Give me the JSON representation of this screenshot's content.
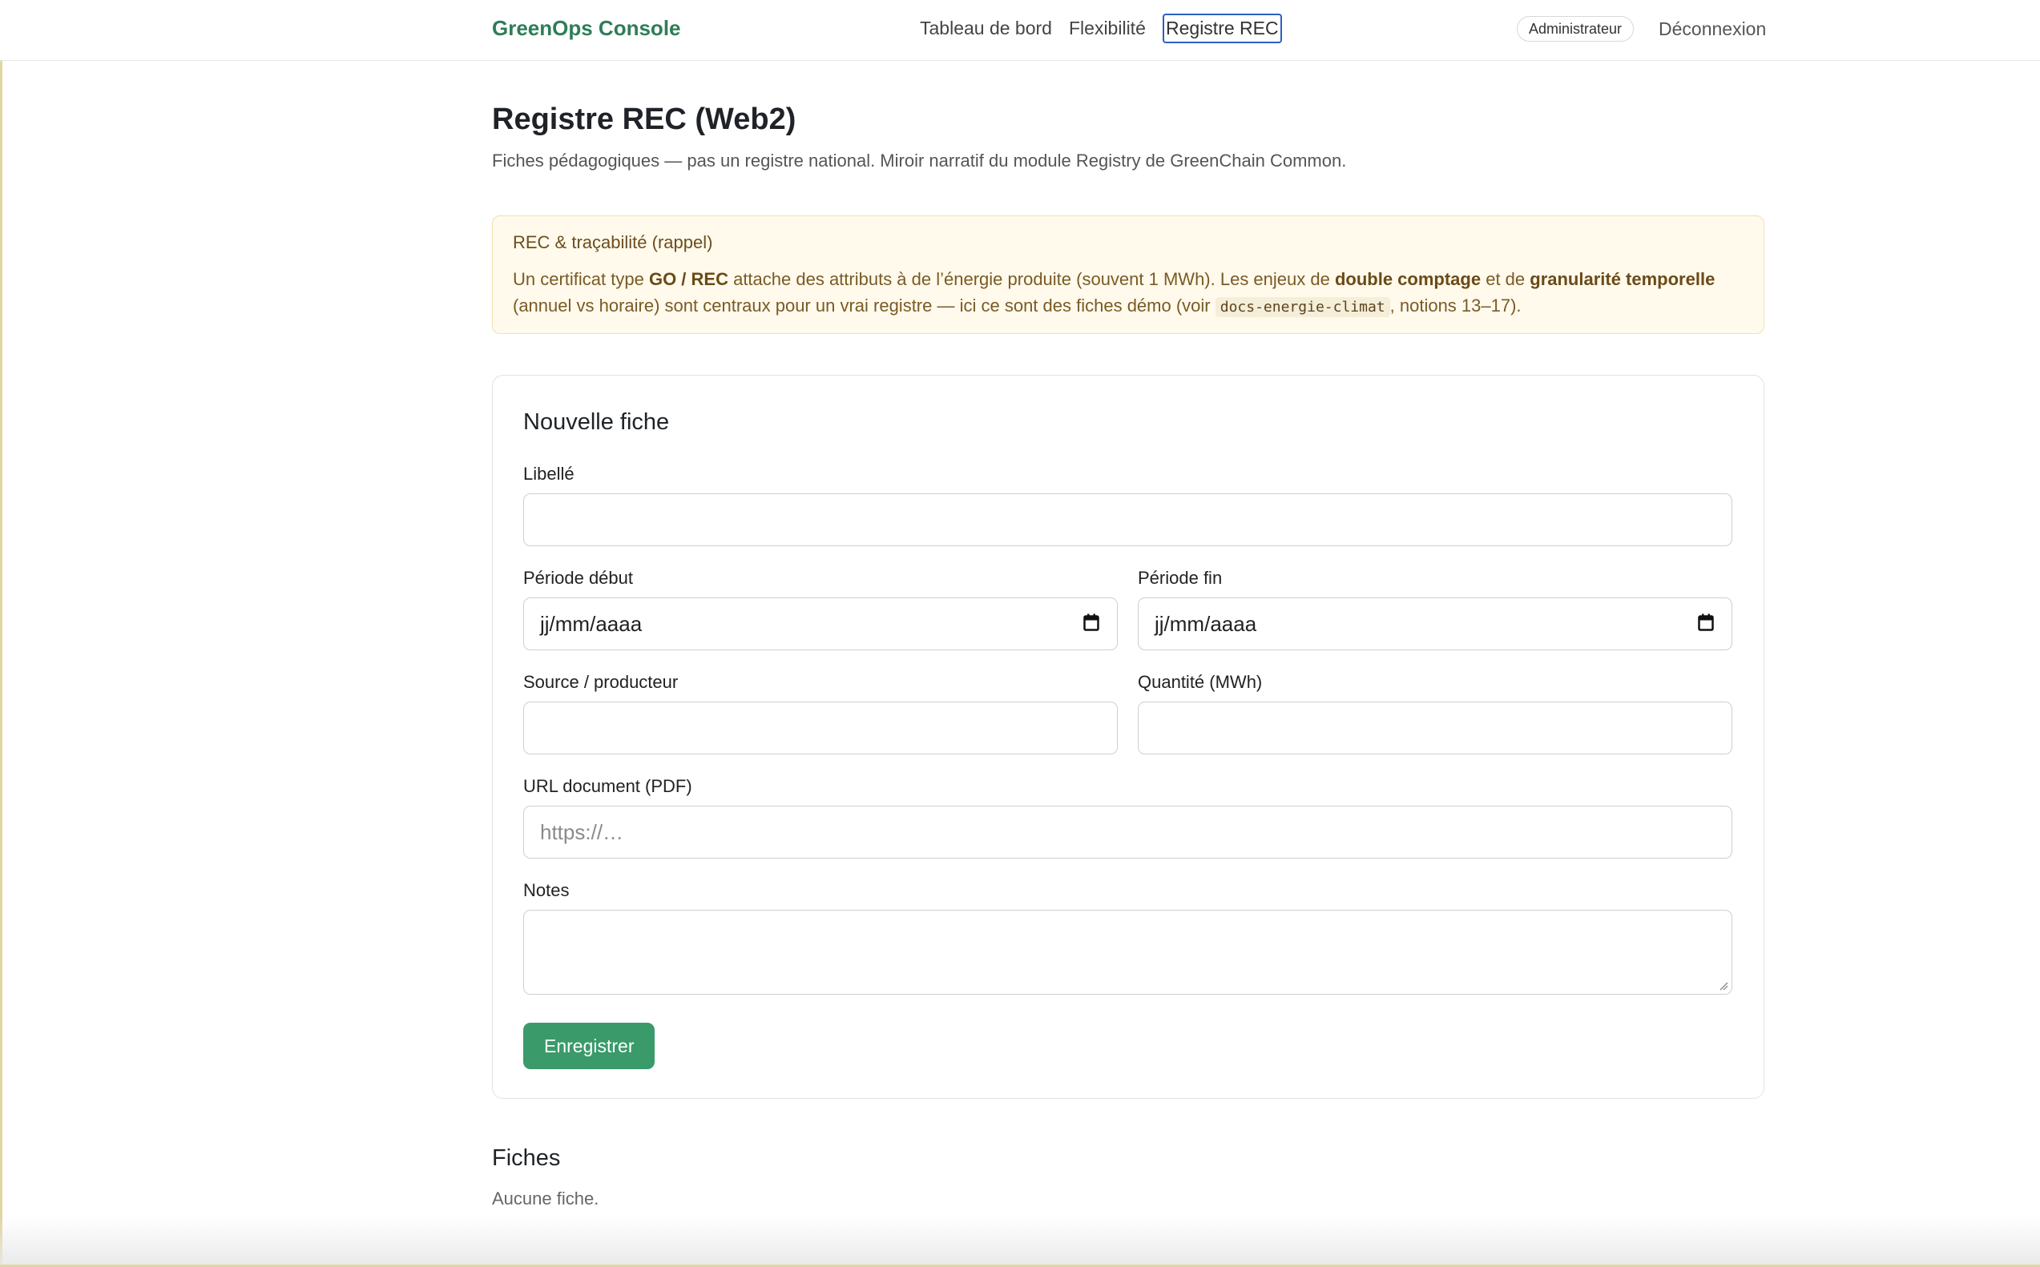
{
  "nav": {
    "brand": "GreenOps Console",
    "links": [
      "Tableau de bord",
      "Flexibilité",
      "Registre REC"
    ],
    "role": "Administrateur",
    "logout": "Déconnexion"
  },
  "page": {
    "title": "Registre REC (Web2)",
    "subtitle": "Fiches pédagogiques — pas un registre national. Miroir narratif du module Registry de GreenChain Common."
  },
  "callout": {
    "title": "REC & traçabilité (rappel)",
    "t1": "Un certificat type ",
    "b1": "GO / REC",
    "t2": " attache des attributs à de l’énergie produite (souvent 1 MWh). Les enjeux de ",
    "b2": "double comptage",
    "t3": " et de ",
    "b3": "granularité temporelle",
    "t4": " (annuel vs horaire) sont centraux pour un vrai registre — ici ce sont des fiches démo (voir ",
    "code": "docs-energie-climat",
    "t5": ", notions 13–17)."
  },
  "form": {
    "title": "Nouvelle fiche",
    "label_libelle": "Libellé",
    "label_debut": "Période début",
    "label_fin": "Période fin",
    "date_placeholder": "jj/mm/aaaa",
    "label_source": "Source / producteur",
    "label_quantite": "Quantité (MWh)",
    "label_url": "URL document (PDF)",
    "url_placeholder": "https://…",
    "label_notes": "Notes",
    "submit": "Enregistrer",
    "values": {
      "libelle": "",
      "source": "",
      "quantite": "",
      "url": "",
      "notes": ""
    }
  },
  "list": {
    "title": "Fiches",
    "empty": "Aucune fiche."
  },
  "colors": {
    "brand": "#2e7d57",
    "button": "#3a9a6a",
    "callout_bg": "#fffaeb",
    "focus_outline": "#2b5fbf"
  },
  "icons": {
    "date": "calendar-icon"
  }
}
